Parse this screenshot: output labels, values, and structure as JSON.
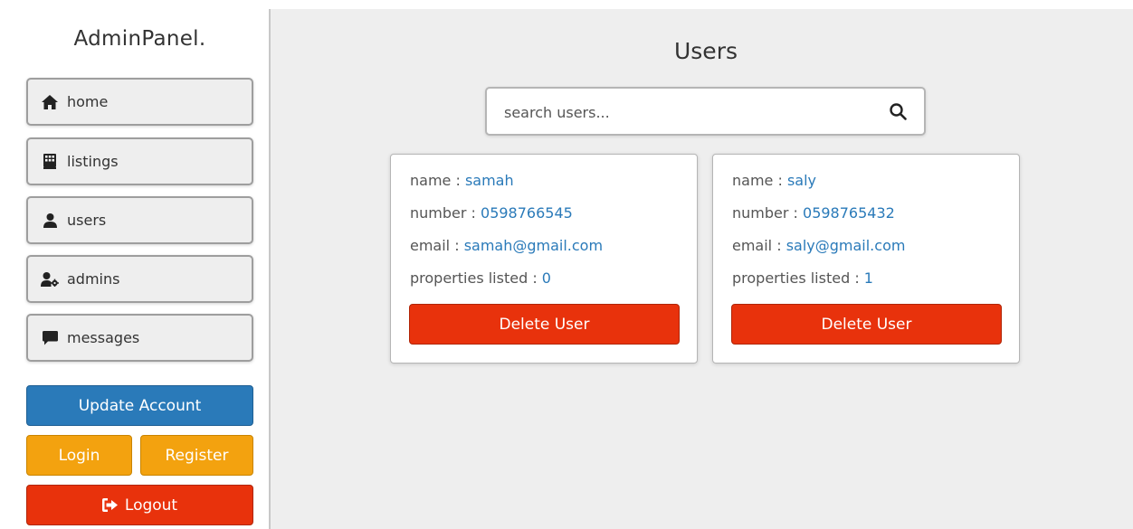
{
  "sidebar": {
    "logo": "AdminPanel.",
    "nav": [
      {
        "label": "home",
        "icon": "home-icon"
      },
      {
        "label": "listings",
        "icon": "building-icon"
      },
      {
        "label": "users",
        "icon": "user-icon"
      },
      {
        "label": "admins",
        "icon": "user-gear-icon"
      },
      {
        "label": "messages",
        "icon": "comment-icon"
      }
    ],
    "update_label": "Update Account",
    "login_label": "Login",
    "register_label": "Register",
    "logout_label": "Logout"
  },
  "main": {
    "title": "Users",
    "search": {
      "placeholder": "search users...",
      "value": ""
    },
    "field_labels": {
      "name": "name : ",
      "number": "number : ",
      "email": "email : ",
      "properties": "properties listed : "
    },
    "delete_label": "Delete User",
    "users": [
      {
        "name": "samah",
        "number": "0598766545",
        "email": "samah@gmail.com",
        "properties_listed": "0"
      },
      {
        "name": "saly",
        "number": "0598765432",
        "email": "saly@gmail.com",
        "properties_listed": "1"
      }
    ]
  },
  "colors": {
    "primary_blue": "#2a7ab9",
    "warning_orange": "#f3a20f",
    "danger_red": "#e8320c",
    "background": "#eeeeee"
  }
}
